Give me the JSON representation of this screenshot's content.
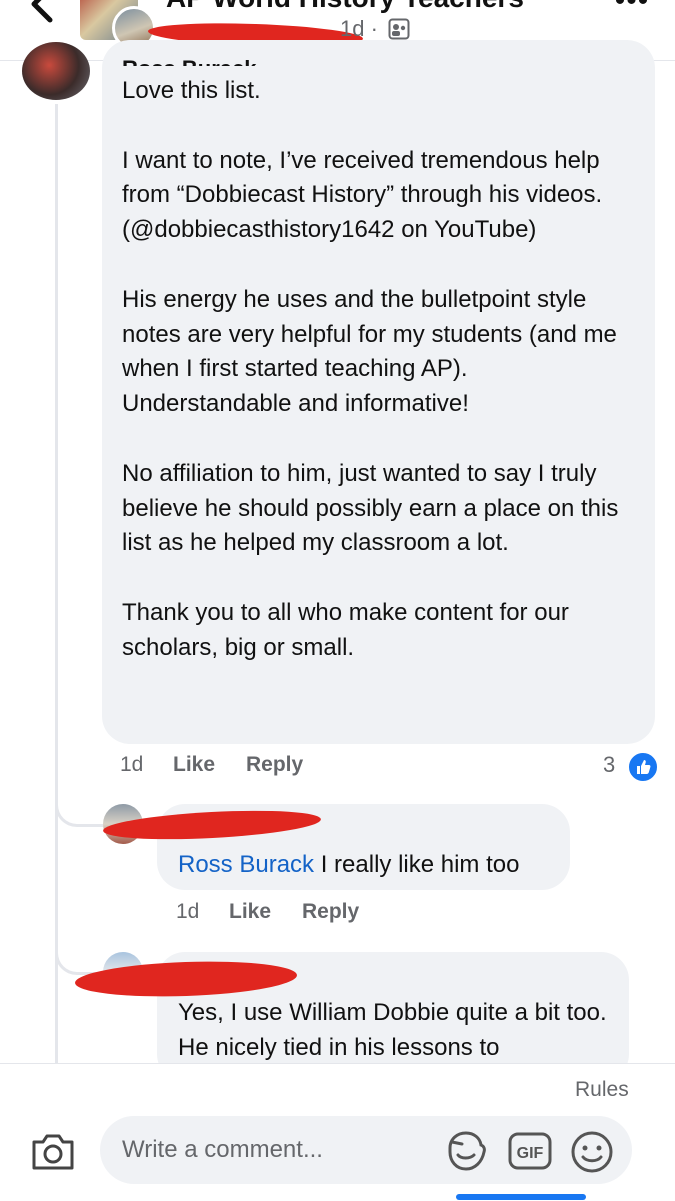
{
  "header": {
    "group_title": "AP World History Teachers",
    "post_time": "1d ·",
    "privacy_icon": "group-members-icon",
    "back_icon": "chevron-left-icon",
    "more_icon": "more-horizontal-icon",
    "more_label": "•••"
  },
  "main_comment": {
    "author_clipped": "Ross Burack",
    "paragraphs": [
      "Love this list.",
      "I want to note, I’ve received tremendous help from “Dobbiecast History” through his videos. (@dobbiecasthistory1642 on YouTube)",
      "His energy he uses and the bulletpoint style notes are very helpful for my students (and me when I first started teaching AP). Understandable and informative!",
      "No affiliation to him, just wanted to say I truly believe he should possibly earn a place on this list as he helped my classroom a lot.",
      "Thank you to all who make content for our scholars, big or small."
    ],
    "time": "1d",
    "like_label": "Like",
    "reply_label": "Reply",
    "reaction_count": "3",
    "reaction_icon": "thumbs-up-icon"
  },
  "replies": [
    {
      "mention": "Ross Burack",
      "text": " I really like him too",
      "time": "1d",
      "like_label": "Like",
      "reply_label": "Reply"
    },
    {
      "text": "Yes, I use William Dobbie quite a bit too.  He nicely tied in his lessons to"
    }
  ],
  "composer": {
    "rules_label": "Rules",
    "placeholder": "Write a comment...",
    "camera_icon": "camera-icon",
    "sticker_icon": "sticker-icon",
    "gif_label": "GIF",
    "emoji_icon": "emoji-icon"
  },
  "colors": {
    "accent": "#1877f2",
    "mention": "#1463c7",
    "bubble": "#f0f2f5",
    "redaction": "#e0261f"
  }
}
